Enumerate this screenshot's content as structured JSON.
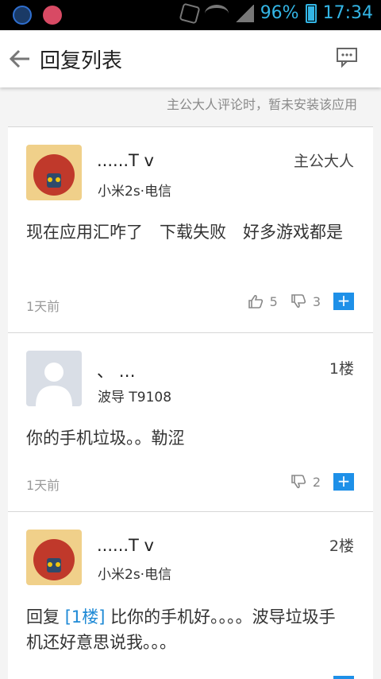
{
  "status_bar": {
    "battery": "96%",
    "time": "17:34"
  },
  "appbar": {
    "title": "回复列表"
  },
  "notice": "主公大人评论时，暂未安装该应用",
  "comments": [
    {
      "name": "......T v",
      "device": "小米2s·电信",
      "floor": "主公大人",
      "content": "现在应用汇咋了　下载失败　好多游戏都是",
      "time": "1天前",
      "likes": "5",
      "dislikes": "3"
    },
    {
      "name": "、 …",
      "device": "波导 T9108",
      "floor": "1楼",
      "content": "你的手机垃圾。。勒涩",
      "time": "1天前",
      "dislikes": "2"
    },
    {
      "name": "......T v",
      "device": "小米2s·电信",
      "floor": "2楼",
      "content_prefix": "回复",
      "reply_ref": "[1楼]",
      "content_rest": "比你的手机好。。。。波导垃圾手机还好意思说我。。。"
    }
  ],
  "colors": {
    "accent": "#1e90e8",
    "status_text": "#33b5e5"
  }
}
